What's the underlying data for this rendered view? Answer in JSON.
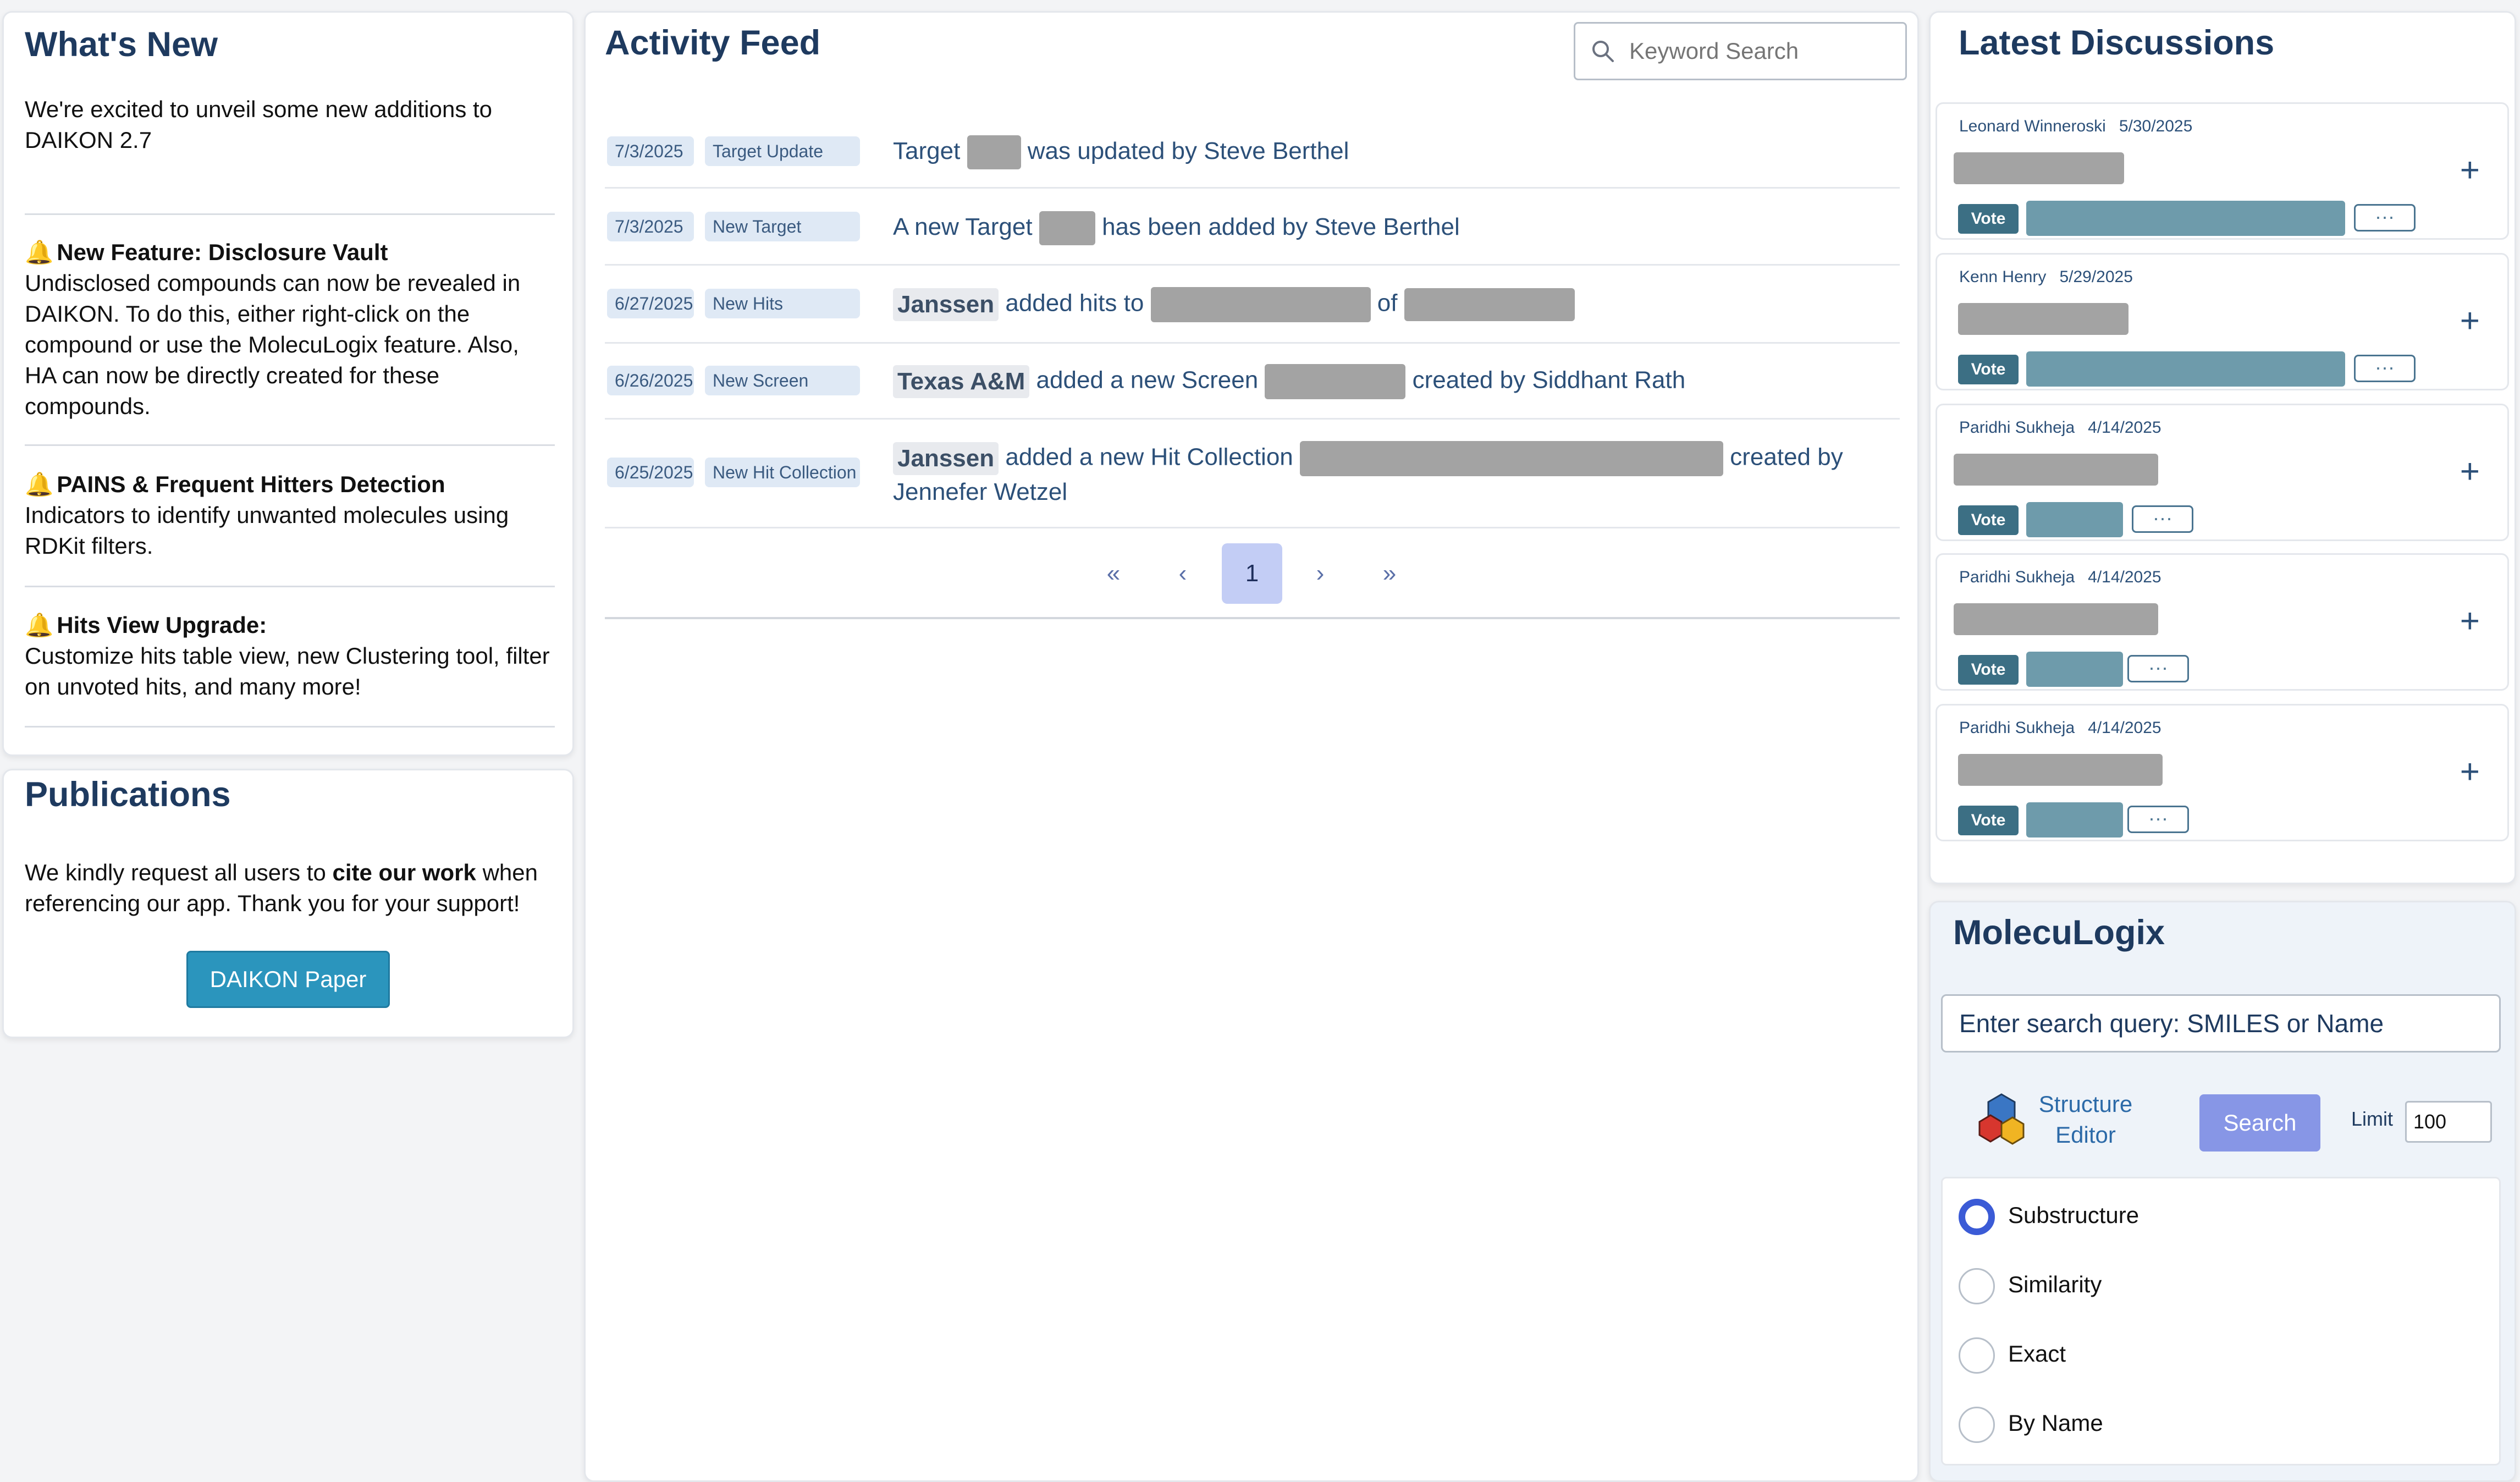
{
  "whats_new": {
    "title": "What's New",
    "intro": "We're excited to unveil some new additions to DAIKON 2.7",
    "items": [
      {
        "icon": "bell-icon",
        "heading": "New Feature: Disclosure Vault",
        "text": "Undisclosed compounds can now be revealed in DAIKON. To do this, either right-click on the compound or use the MolecuLogix feature. Also, HA can now be directly created for these compounds."
      },
      {
        "icon": "bell-icon",
        "heading": "PAINS & Frequent Hitters Detection",
        "text": "Indicators to identify unwanted molecules using RDKit filters."
      },
      {
        "icon": "bell-icon",
        "heading": "Hits View Upgrade:",
        "text": "Customize hits table view, new Clustering tool, filter on unvoted hits, and many more!"
      }
    ]
  },
  "publications": {
    "title": "Publications",
    "text_before": "We kindly request all users to",
    "text_bold": "cite our work",
    "text_after": "when referencing our app. Thank you for your support!",
    "button_label": "DAIKON Paper"
  },
  "activity_feed": {
    "title": "Activity Feed",
    "search_placeholder": "Keyword Search",
    "rows": [
      {
        "date": "7/3/2025",
        "type": "Target Update",
        "parts": [
          "Target",
          "was updated by Steve Berthel"
        ]
      },
      {
        "date": "7/3/2025",
        "type": "New Target",
        "parts": [
          "A new Target",
          "has been added by Steve Berthel"
        ]
      },
      {
        "date": "6/27/2025",
        "type": "New Hits",
        "org": "Janssen",
        "parts": [
          "added hits to",
          "of"
        ]
      },
      {
        "date": "6/26/2025",
        "type": "New Screen",
        "org": "Texas A&M",
        "parts": [
          "added a new Screen",
          "created by Siddhant Rath"
        ]
      },
      {
        "date": "6/25/2025",
        "type": "New Hit Collection",
        "org": "Janssen",
        "parts": [
          "added a new Hit Collection",
          "created by",
          "Jennefer Wetzel"
        ]
      }
    ],
    "pager": {
      "first": "«",
      "prev": "‹",
      "page": "1",
      "next": "›",
      "last": "»"
    }
  },
  "discussions": {
    "title": "Latest Discussions",
    "vote_label": "Vote",
    "more_label": "···",
    "items": [
      {
        "author": "Leonard Winneroski",
        "date": "5/30/2025"
      },
      {
        "author": "Kenn Henry",
        "date": "5/29/2025"
      },
      {
        "author": "Paridhi Sukheja",
        "date": "4/14/2025"
      },
      {
        "author": "Paridhi Sukheja",
        "date": "4/14/2025"
      },
      {
        "author": "Paridhi Sukheja",
        "date": "4/14/2025"
      }
    ]
  },
  "moleculogix": {
    "title": "MolecuLogix",
    "search_placeholder": "Enter search query: SMILES or Name",
    "structure_editor_label": "Structure Editor",
    "search_button": "Search",
    "limit_label": "Limit",
    "limit_value": "100",
    "options": [
      {
        "label": "Substructure",
        "checked": true
      },
      {
        "label": "Similarity",
        "checked": false
      },
      {
        "label": "Exact",
        "checked": false
      },
      {
        "label": "By Name",
        "checked": false
      }
    ]
  }
}
